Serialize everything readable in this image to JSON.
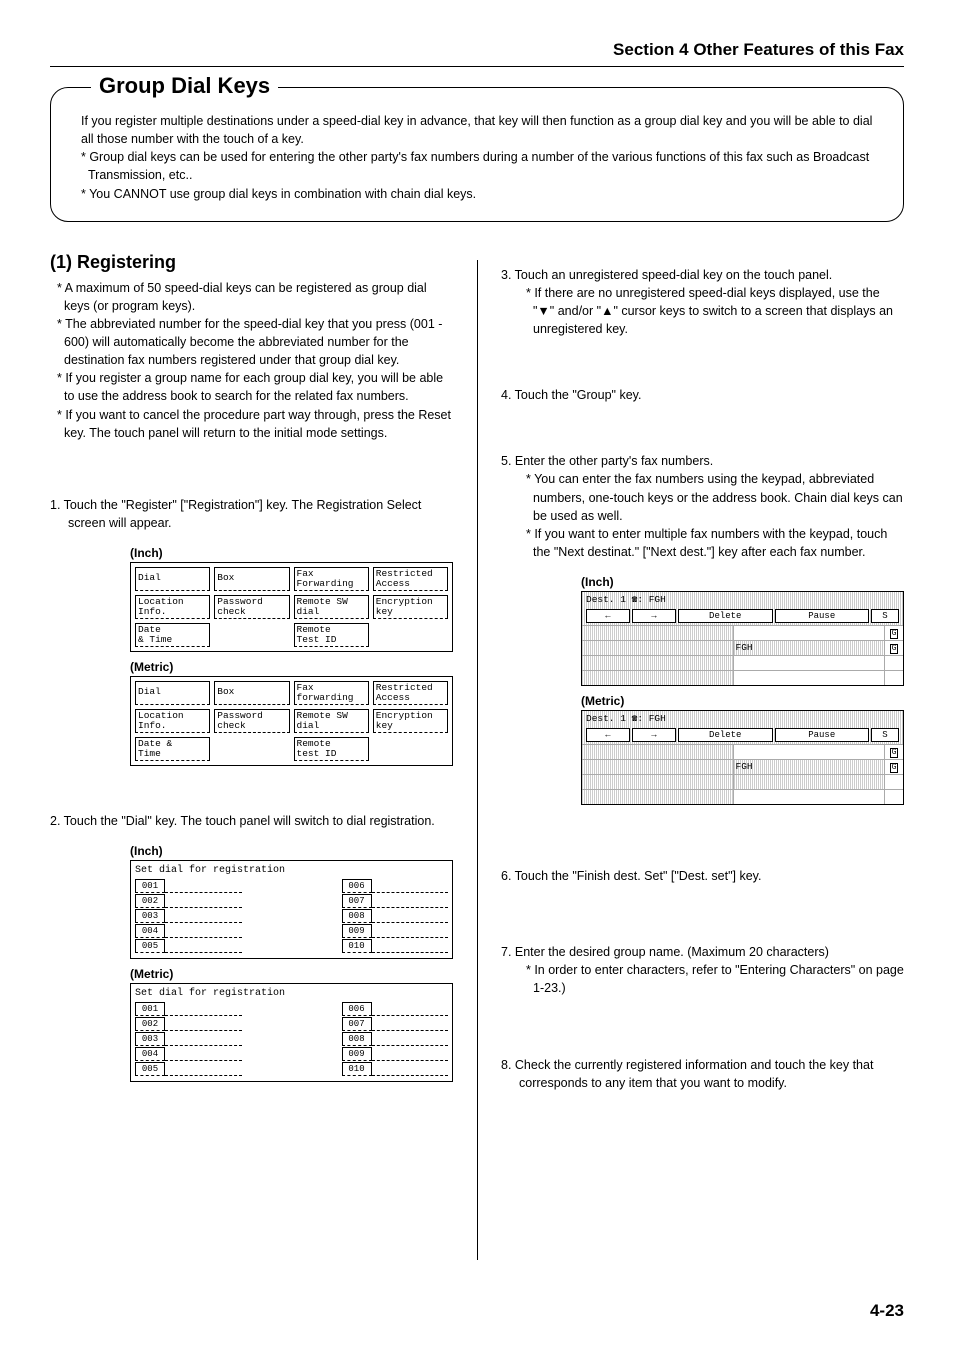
{
  "header": {
    "section": "Section 4 Other Features of this Fax"
  },
  "callout": {
    "title": "Group Dial Keys",
    "intro": "If you register multiple destinations under a speed-dial key in advance, that key will then function as a group dial key and you will be able to dial all those number with the touch of a key.",
    "note1": "* Group dial keys can be used for entering the other party's fax numbers during a number of the various functions of this fax such as Broadcast Transmission, etc..",
    "note2": "* You CANNOT use group dial keys in combination with chain dial keys."
  },
  "registering": {
    "title": "(1) Registering",
    "n1": "* A maximum of 50 speed-dial keys can be registered as group dial keys (or program keys).",
    "n2": "* The abbreviated number for the speed-dial key that you press (001 - 600) will automatically become the abbreviated number for the destination fax numbers registered under that group dial key.",
    "n3": "* If you register a group name for each group dial key, you will be able to use the address book to search for the related fax numbers.",
    "n4": "* If you want to cancel the procedure part way through, press the Reset key. The touch panel will return to the initial mode settings."
  },
  "step1": {
    "text": "1. Touch the \"Register\" [\"Registration\"] key. The Registration Select screen will appear."
  },
  "labels": {
    "inch": "(Inch)",
    "metric": "(Metric)"
  },
  "panel1": {
    "r1": [
      "Dial",
      "Box",
      "Fax\nForwarding",
      "Restricted\nAccess"
    ],
    "r2": [
      "Location\nInfo.",
      "Password\ncheck",
      "Remote SW\ndial",
      "Encryption\nkey"
    ],
    "r3": [
      "Date\n& Time",
      "",
      "Remote\nTest ID",
      ""
    ]
  },
  "panel1m": {
    "r1": [
      "Dial",
      "Box",
      "Fax\nforwarding",
      "Restricted\nAccess"
    ],
    "r2": [
      "Location\nInfo.",
      "Password\ncheck",
      "Remote SW\ndial",
      "Encryption\nkey"
    ],
    "r3": [
      "Date &\nTime",
      "",
      "Remote\ntest ID",
      ""
    ]
  },
  "step2": {
    "text": "2. Touch the \"Dial\" key. The touch panel will switch to dial registration."
  },
  "panel2": {
    "title": "Set dial for registration",
    "left": [
      "001",
      "002",
      "003",
      "004",
      "005"
    ],
    "right": [
      "006",
      "007",
      "008",
      "009",
      "010"
    ]
  },
  "step3": {
    "text": "3. Touch an unregistered speed-dial key on the touch panel.",
    "note": "* If there are no unregistered speed-dial keys displayed, use the \"▼\" and/or \"▲\" cursor keys to switch to a screen that displays an unregistered key."
  },
  "step4": {
    "text": "4. Touch the \"Group\" key."
  },
  "step5": {
    "text": "5. Enter the other party's fax numbers.",
    "note1": "* You can enter the fax numbers using the keypad, abbreviated numbers, one-touch keys or the address book. Chain dial keys can be used as well.",
    "note2": "* If you want to enter multiple fax numbers with the keypad, touch the \"Next destinat.\" [\"Next dest.\"] key after each fax number."
  },
  "destpanel": {
    "header": "Dest.  1 ☎: FGH",
    "btn1": "←",
    "btn2": "→",
    "btn3": "Delete",
    "btn4": "Pause",
    "btn5": "S",
    "row2mid": "FGH",
    "g": "G"
  },
  "step6": {
    "text": "6. Touch the \"Finish dest. Set\" [\"Dest. set\"] key."
  },
  "step7": {
    "text": "7. Enter the desired group name. (Maximum 20 characters)",
    "note": "* In order to enter characters, refer to \"Entering Characters\" on page 1-23.)"
  },
  "step8": {
    "text": "8. Check the currently registered information and touch the key that corresponds to any item that you want to modify."
  },
  "pagenum": "4-23"
}
